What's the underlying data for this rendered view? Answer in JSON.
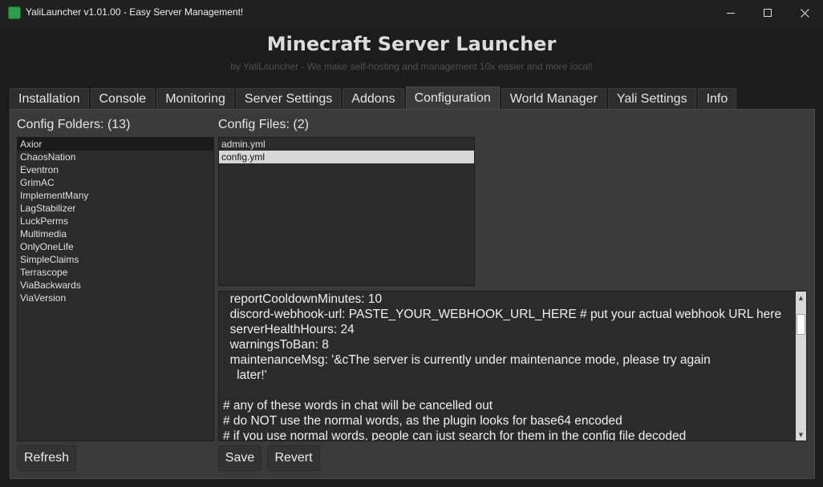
{
  "window": {
    "title": "YaliLauncher v1.01.00 - Easy Server Management!",
    "icon": "app-icon",
    "controls": [
      "minimize-icon",
      "maximize-icon",
      "close-icon"
    ]
  },
  "header": {
    "title": "Minecraft Server Launcher",
    "subtitle": "by YaliLauncher - We make self-hosting and management 10x easier and more local!"
  },
  "tabs": [
    {
      "label": "Installation",
      "active": false
    },
    {
      "label": "Console",
      "active": false
    },
    {
      "label": "Monitoring",
      "active": false
    },
    {
      "label": "Server Settings",
      "active": false
    },
    {
      "label": "Addons",
      "active": false
    },
    {
      "label": "Configuration",
      "active": true
    },
    {
      "label": "World Manager",
      "active": false
    },
    {
      "label": "Yali Settings",
      "active": false
    },
    {
      "label": "Info",
      "active": false
    }
  ],
  "folders": {
    "label": "Config Folders: (13)",
    "items": [
      "Axior",
      "ChaosNation",
      "Eventron",
      "GrimAC",
      "ImplementMany",
      "LagStabilizer",
      "LuckPerms",
      "Multimedia",
      "OnlyOneLife",
      "SimpleClaims",
      "Terrascope",
      "ViaBackwards",
      "ViaVersion"
    ],
    "selected": "Axior",
    "refresh_label": "Refresh"
  },
  "files": {
    "label": "Config Files: (2)",
    "items": [
      "admin.yml",
      "config.yml"
    ],
    "selected": "config.yml"
  },
  "editor": {
    "lines": [
      "  reportCooldownMinutes: 10",
      "  discord-webhook-url: PASTE_YOUR_WEBHOOK_URL_HERE # put your actual webhook URL here",
      "  serverHealthHours: 24",
      "  warningsToBan: 8",
      "  maintenanceMsg: '&cThe server is currently under maintenance mode, please try again",
      "    later!'",
      "",
      "# any of these words in chat will be cancelled out",
      "# do NOT use the normal words, as the plugin looks for base64 encoded",
      "# if you use normal words, people can just search for them in the config file decoded"
    ],
    "save_label": "Save",
    "revert_label": "Revert"
  },
  "colors": {
    "window_bg": "#1c1c1c",
    "panel_bg": "#3a3a3a",
    "list_bg": "#2b2b2b",
    "tab_bg": "#2e2e2e",
    "selected_file_bg": "#d8d8d8"
  }
}
